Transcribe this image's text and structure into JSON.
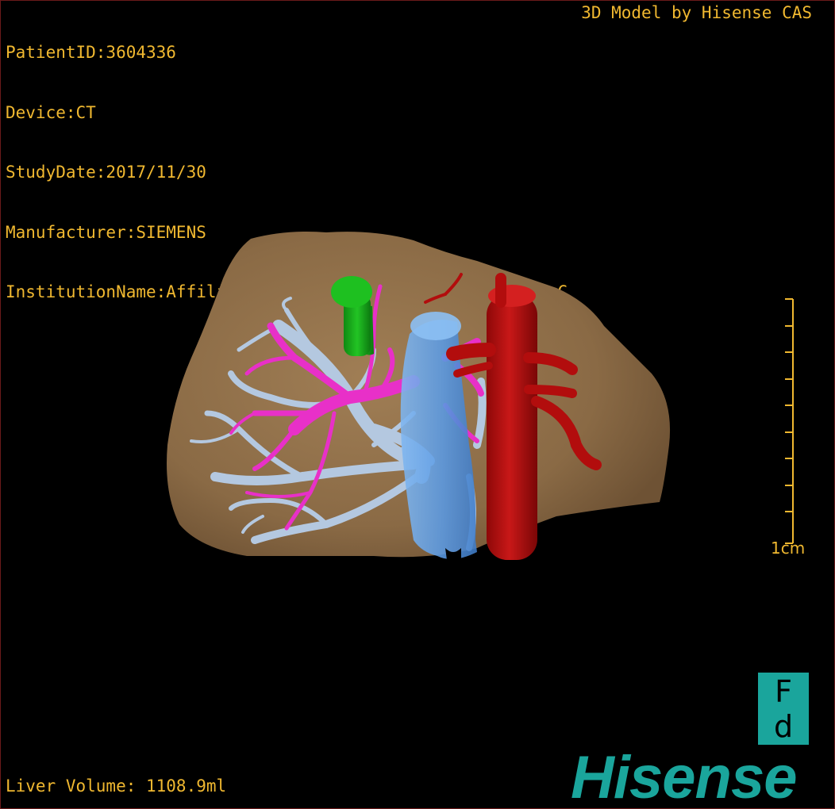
{
  "header": {
    "patient_id": "PatientID:3604336",
    "device": "Device:CT",
    "study_date": "StudyDate:2017/11/30",
    "manufacturer": "Manufacturer:SIEMENS",
    "institution": "InstitutionName:Affiliated Hospital Qingdao University-C"
  },
  "credit": "3D Model by Hisense CAS",
  "footer": {
    "liver_volume": "Liver Volume: 1108.9ml"
  },
  "scale": {
    "label": "1cm"
  },
  "orientation": {
    "top": "F",
    "bottom": "d"
  },
  "brand": {
    "logo_text": "Hisense"
  },
  "model": {
    "structures": [
      "liver-surface",
      "portal-vein-branches",
      "hepatic-vein-branches",
      "inferior-vena-cava",
      "abdominal-aorta",
      "gallbladder-or-duct-segment"
    ]
  },
  "colors": {
    "overlay_text": "#f0b830",
    "liver": "#8a6a45",
    "hepatic_veins": "#b4c8e0",
    "portal_veins": "#e830c8",
    "vena_cava": "#5ea0e8",
    "aorta": "#b20d0d",
    "green_structure": "#16b018",
    "brand_teal": "#1aa59c",
    "background": "#000000"
  }
}
